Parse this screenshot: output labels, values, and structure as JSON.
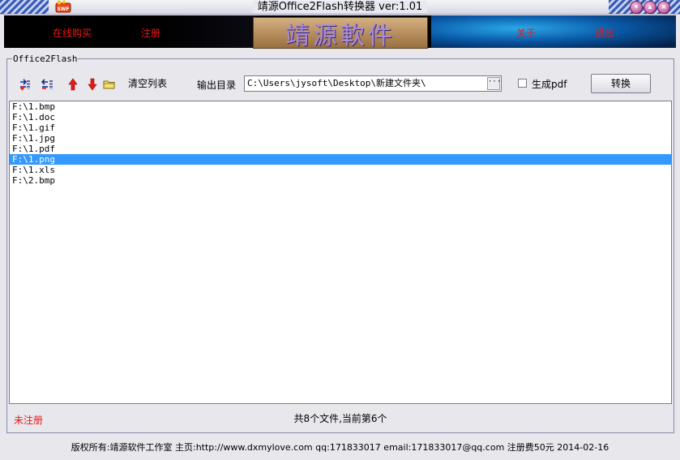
{
  "window": {
    "title": "靖源Office2Flash转换器 ver:1.01",
    "app_icon_text": "SWF"
  },
  "banner": {
    "buy_online": "在线购买",
    "register": "注册",
    "logo_text": "靖源軟件",
    "about": "关于",
    "exit": "退出"
  },
  "group": {
    "title": "Office2Flash",
    "clear_list": "清空列表",
    "output_label": "输出目录",
    "output_path": "C:\\Users\\jysoft\\Desktop\\新建文件夹\\",
    "browse_label": "···",
    "pdf_label": "生成pdf",
    "pdf_checked": false,
    "convert_label": "转换"
  },
  "files": [
    {
      "path": "F:\\1.bmp",
      "selected": false
    },
    {
      "path": "F:\\1.doc",
      "selected": false
    },
    {
      "path": "F:\\1.gif",
      "selected": false
    },
    {
      "path": "F:\\1.jpg",
      "selected": false
    },
    {
      "path": "F:\\1.pdf",
      "selected": false
    },
    {
      "path": "F:\\1.png",
      "selected": true
    },
    {
      "path": "F:\\1.xls",
      "selected": false
    },
    {
      "path": "F:\\2.bmp",
      "selected": false
    }
  ],
  "status": {
    "registration": "未注册",
    "summary": "共8个文件,当前第6个"
  },
  "footer": {
    "text": "版权所有:靖源软件工作室 主页:http://www.dxmylove.com qq:171833017 email:171833017@qq.com 注册费50元 2014-02-16"
  },
  "colors": {
    "accent_red": "#e81818",
    "selection_blue": "#3399ff"
  }
}
